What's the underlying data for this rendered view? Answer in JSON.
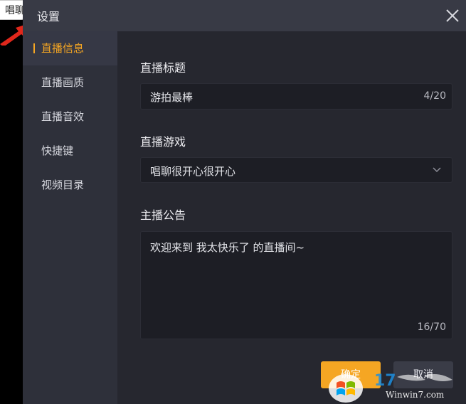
{
  "background": {
    "partial_text": "唱聊"
  },
  "dialog": {
    "title": "设置",
    "sidebar": {
      "items": [
        {
          "label": "直播信息",
          "active": true
        },
        {
          "label": "直播画质",
          "active": false
        },
        {
          "label": "直播音效",
          "active": false
        },
        {
          "label": "快捷键",
          "active": false
        },
        {
          "label": "视频目录",
          "active": false
        }
      ]
    },
    "stream_title": {
      "label": "直播标题",
      "value": "游拍最棒",
      "counter": "4/20"
    },
    "stream_game": {
      "label": "直播游戏",
      "value": "唱聊很开心很开心"
    },
    "announcement": {
      "label": "主播公告",
      "value": "欢迎来到 我太快乐了 的直播间~",
      "counter": "16/70"
    },
    "buttons": {
      "confirm": "确定",
      "cancel": "取消"
    }
  },
  "watermark": {
    "text": "Winwin7.com"
  },
  "colors": {
    "accent": "#f5a623",
    "panel": "#26272f",
    "sidebar": "#2e303a",
    "titlebar": "#383a45",
    "field": "#1d1e25"
  }
}
